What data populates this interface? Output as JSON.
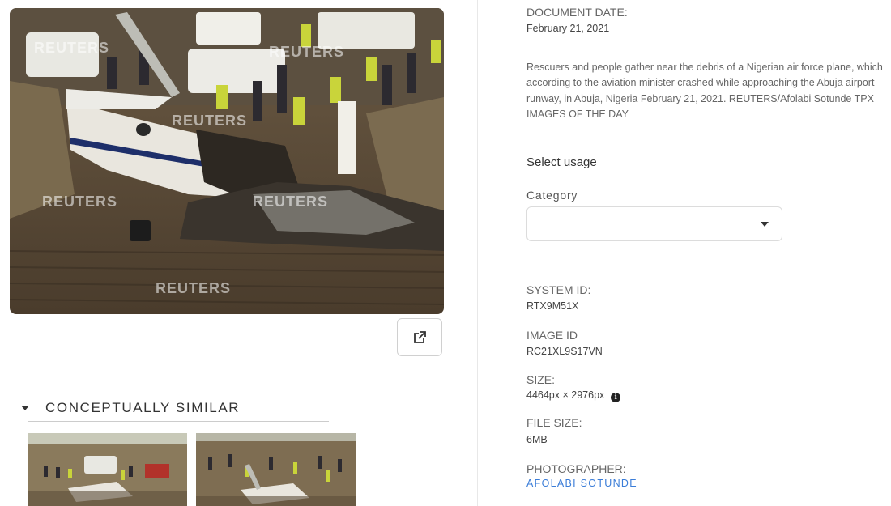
{
  "photo": {
    "watermark": "REUTERS"
  },
  "open_button": {
    "icon": "external-link-icon"
  },
  "similar": {
    "heading": "CONCEPTUALLY SIMILAR"
  },
  "details": {
    "document_date_label": "DOCUMENT DATE:",
    "document_date": "February 21, 2021",
    "caption": "Rescuers and people gather near the debris of a Nigerian air force plane, which according to the aviation minister crashed while approaching the Abuja airport runway, in Abuja, Nigeria February 21, 2021. REUTERS/Afolabi Sotunde TPX IMAGES OF THE DAY",
    "select_usage": "Select usage",
    "category_label": "Category",
    "category_value": "",
    "system_id_label": "SYSTEM ID:",
    "system_id": "RTX9M51X",
    "image_id_label": "IMAGE ID",
    "image_id": "RC21XL9S17VN",
    "size_label": "SIZE:",
    "size": "4464px × 2976px",
    "file_size_label": "FILE SIZE:",
    "file_size": "6MB",
    "photographer_label": "PHOTOGRAPHER:",
    "photographer": "AFOLABI SOTUNDE"
  }
}
